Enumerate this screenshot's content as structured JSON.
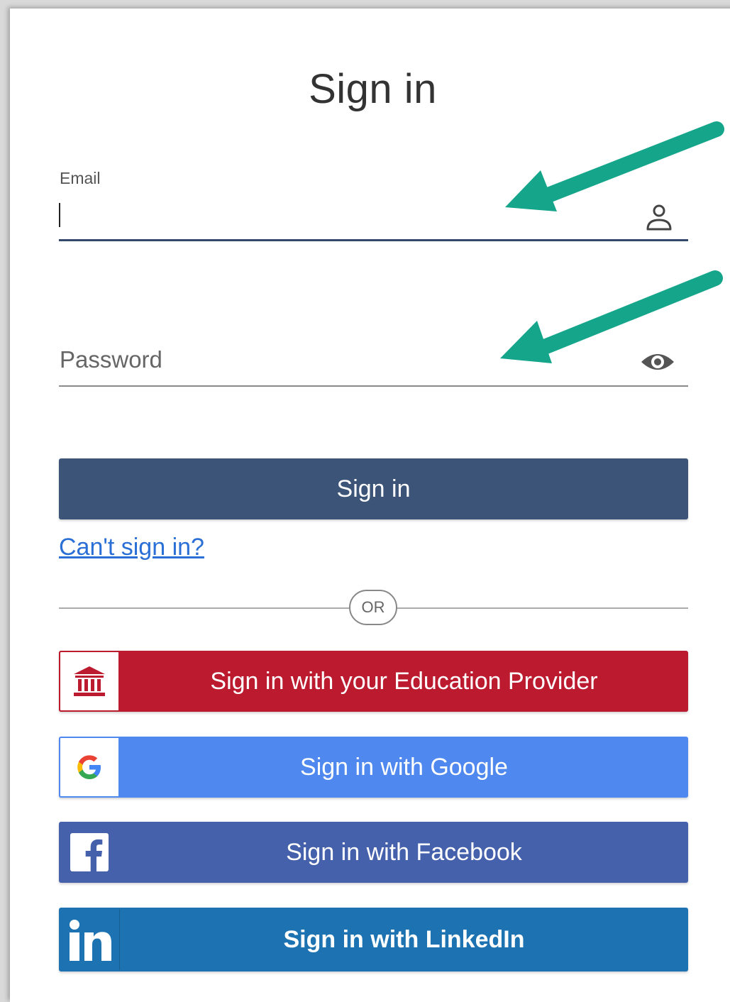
{
  "page": {
    "title": "Sign in"
  },
  "form": {
    "email": {
      "label": "Email",
      "value": ""
    },
    "password": {
      "placeholder": "Password",
      "value": ""
    },
    "signin_button": "Sign in",
    "cant_signin_link": "Can't sign in?",
    "divider_text": "OR"
  },
  "sso": {
    "education_provider": "Sign in with your Education Provider",
    "google": "Sign in with Google",
    "facebook": "Sign in with Facebook",
    "linkedin": "Sign in with LinkedIn"
  },
  "colors": {
    "primary": "#3b5478",
    "education": "#bb1a2f",
    "google": "#4f88ee",
    "facebook": "#4561ab",
    "linkedin": "#1d73b2",
    "link": "#2a6fd6",
    "annotation_arrow": "#14a58a"
  },
  "icons": {
    "email_field": "user-icon",
    "password_field": "eye-icon",
    "education": "institution-icon",
    "google": "google-logo-icon",
    "facebook": "facebook-logo-icon",
    "linkedin": "linkedin-logo-icon"
  }
}
